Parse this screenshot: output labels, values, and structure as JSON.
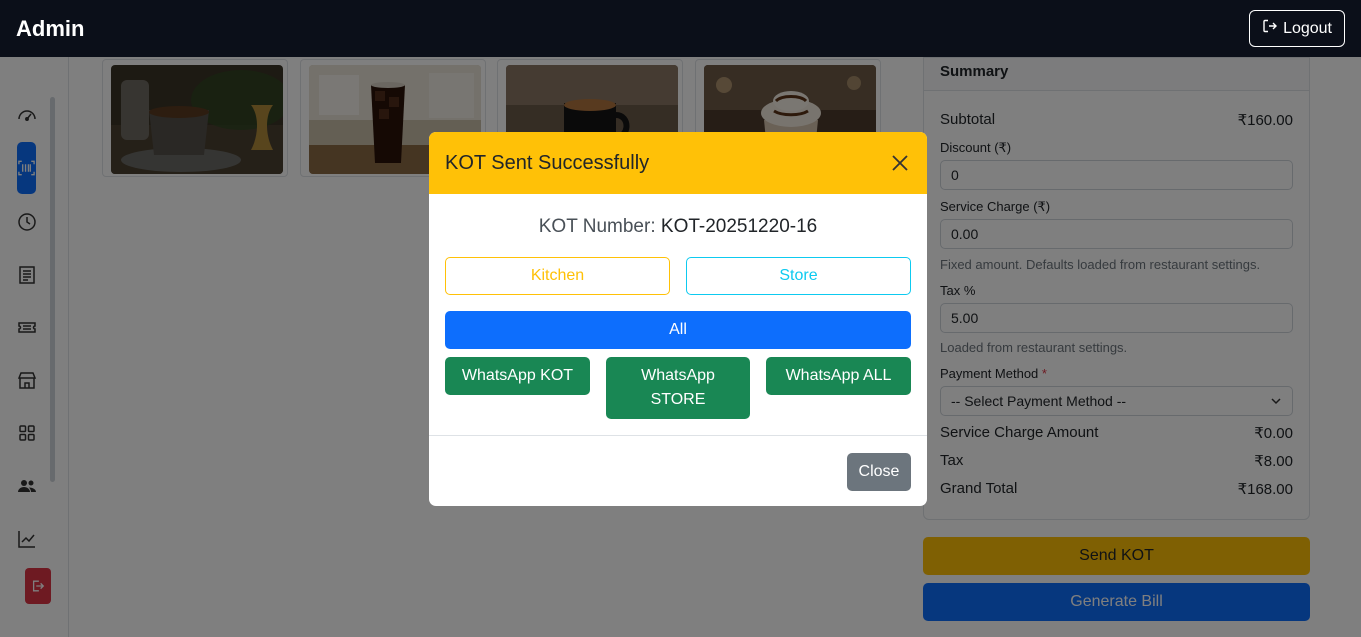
{
  "app": {
    "brand": "Admin",
    "logout_label": "Logout"
  },
  "sidebar": {
    "items": [
      {
        "icon": "speedometer-icon"
      },
      {
        "icon": "barcode-scan-icon",
        "active": true
      },
      {
        "icon": "clock-history-icon"
      },
      {
        "icon": "receipt-icon"
      },
      {
        "icon": "ticket-icon"
      },
      {
        "icon": "shop-icon"
      },
      {
        "icon": "grid-icon"
      },
      {
        "icon": "people-icon"
      },
      {
        "icon": "graph-up-icon"
      }
    ],
    "exit_icon": "box-arrow-right-icon"
  },
  "products": [
    {
      "image": "filter-coffee"
    },
    {
      "image": "iced-cola"
    },
    {
      "image": "espresso-mug"
    },
    {
      "image": "mocha-whipped"
    }
  ],
  "summary": {
    "title": "Summary",
    "subtotal_label": "Subtotal",
    "subtotal_value": "₹160.00",
    "discount_label": "Discount (₹)",
    "discount_value": "0",
    "service_charge_label": "Service Charge (₹)",
    "service_charge_value": "0.00",
    "service_charge_help": "Fixed amount. Defaults loaded from restaurant settings.",
    "tax_label": "Tax %",
    "tax_value": "5.00",
    "tax_help": "Loaded from restaurant settings.",
    "payment_label": "Payment Method",
    "payment_required": "*",
    "payment_value": "-- Select Payment Method --",
    "service_amount_label": "Service Charge Amount",
    "service_amount_value": "₹0.00",
    "tax_amount_label": "Tax",
    "tax_amount_value": "₹8.00",
    "grand_total_label": "Grand Total",
    "grand_total_value": "₹168.00"
  },
  "actions": {
    "send_kot": "Send KOT",
    "generate_bill": "Generate Bill"
  },
  "modal": {
    "title": "KOT Sent Successfully",
    "kot_label": "KOT Number:",
    "kot_number": "KOT-20251220-16",
    "kitchen": "Kitchen",
    "store": "Store",
    "all": "All",
    "whatsapp_kot": "WhatsApp KOT",
    "whatsapp_store": "WhatsApp STORE",
    "whatsapp_all": "WhatsApp ALL",
    "close": "Close"
  },
  "colors": {
    "navbar": "#0b0f19",
    "primary": "#0d6efd",
    "warning": "#ffc107",
    "info": "#0dcaf0",
    "success": "#198754",
    "danger": "#dc3545",
    "secondary": "#6c757d"
  }
}
